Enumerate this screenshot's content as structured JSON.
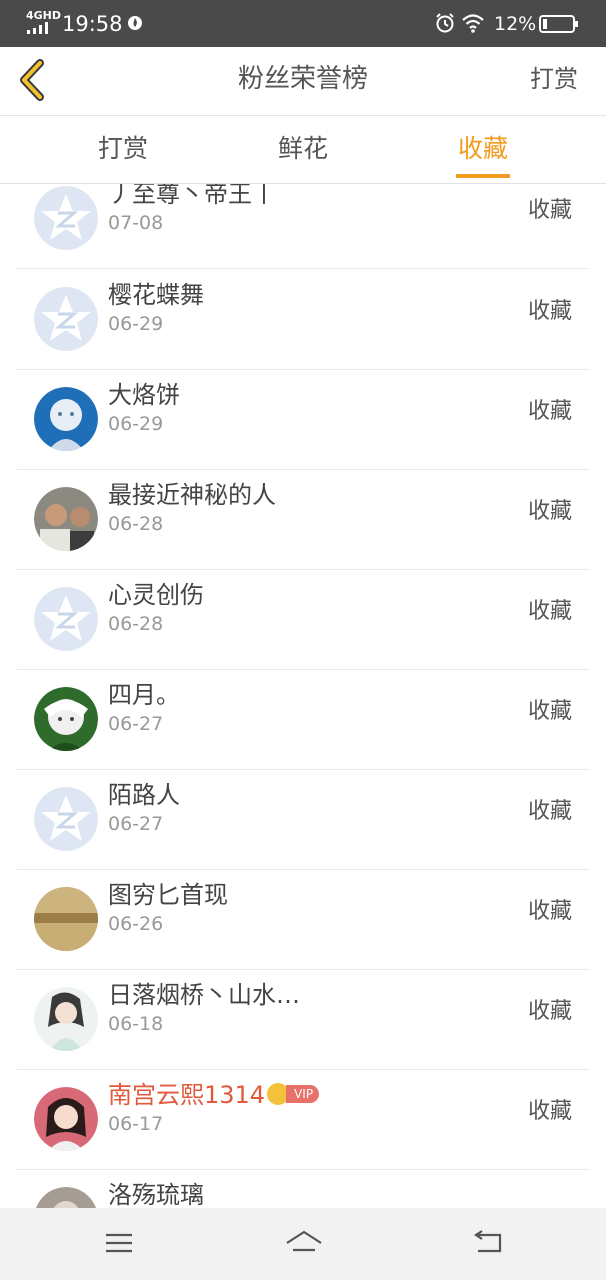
{
  "status_bar": {
    "network": "4GHD",
    "time": "19:58",
    "battery": "12%",
    "icons": [
      "signal-icon",
      "flame-icon",
      "alarm-icon",
      "wifi-icon",
      "battery-icon"
    ]
  },
  "header": {
    "back_icon": "chevron-left-icon",
    "title": "粉丝荣誉榜",
    "action": "打赏"
  },
  "tabs": [
    {
      "label": "打赏",
      "active": false
    },
    {
      "label": "鲜花",
      "active": false
    },
    {
      "label": "收藏",
      "active": true
    }
  ],
  "colors": {
    "accent": "#f29c1f",
    "vip_name": "#e0593b",
    "text": "#444444",
    "subtle": "#999999"
  },
  "fans": [
    {
      "name": "丿至尊丶帝王丨",
      "date": "07-08",
      "action": "收藏",
      "avatar": "default-avatar-icon"
    },
    {
      "name": "樱花蝶舞",
      "date": "06-29",
      "action": "收藏",
      "avatar": "default-avatar-icon"
    },
    {
      "name": "大烙饼",
      "date": "06-29",
      "action": "收藏",
      "avatar": "photo-avatar"
    },
    {
      "name": "最接近神秘的人",
      "date": "06-28",
      "action": "收藏",
      "avatar": "photo-avatar"
    },
    {
      "name": "心灵创伤",
      "date": "06-28",
      "action": "收藏",
      "avatar": "default-avatar-icon"
    },
    {
      "name": "四月。",
      "date": "06-27",
      "action": "收藏",
      "avatar": "photo-avatar"
    },
    {
      "name": "陌路人",
      "date": "06-27",
      "action": "收藏",
      "avatar": "default-avatar-icon"
    },
    {
      "name": "图穷匕首现",
      "date": "06-26",
      "action": "收藏",
      "avatar": "photo-avatar"
    },
    {
      "name": "日落烟桥丶山水…",
      "date": "06-18",
      "action": "收藏",
      "avatar": "photo-avatar"
    },
    {
      "name": "南宫云熙1314",
      "date": "06-17",
      "action": "收藏",
      "avatar": "photo-avatar",
      "vip": "VIP"
    },
    {
      "name": "洛殇琉璃",
      "date": "",
      "action": "",
      "avatar": "photo-avatar"
    }
  ],
  "nav_bar": {
    "icons": [
      "menu-icon",
      "home-icon",
      "back-icon"
    ]
  }
}
